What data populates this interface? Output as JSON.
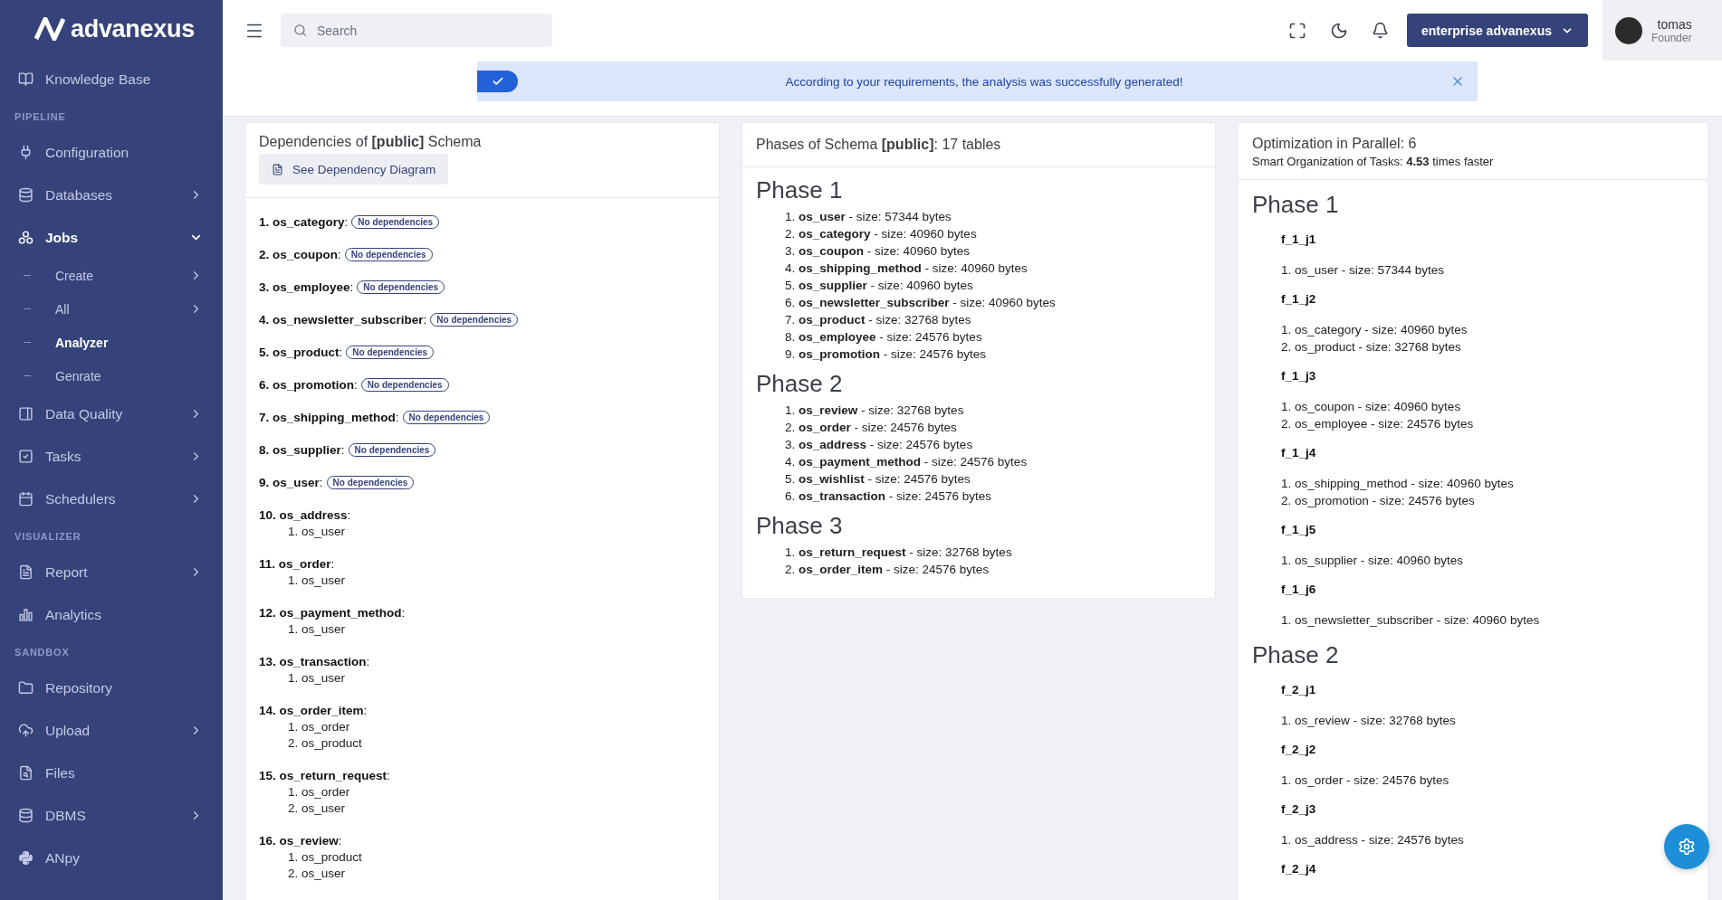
{
  "sidebar": {
    "logo": "advanexus",
    "items": [
      {
        "kind": "link",
        "label": "Knowledge Base",
        "selected": false
      },
      {
        "kind": "section",
        "label": "PIPELINE"
      },
      {
        "kind": "link",
        "label": "Configuration",
        "selected": false
      },
      {
        "kind": "group",
        "label": "Databases",
        "expanded": false
      },
      {
        "kind": "group",
        "label": "Jobs",
        "expanded": true
      },
      {
        "kind": "subgroup",
        "label": "Create",
        "expanded": false
      },
      {
        "kind": "subgroup",
        "label": "All",
        "expanded": false
      },
      {
        "kind": "subitem",
        "label": "Analyzer",
        "selected": true
      },
      {
        "kind": "subitem",
        "label": "Genrate",
        "selected": false
      },
      {
        "kind": "group",
        "label": "Data Quality",
        "expanded": false
      },
      {
        "kind": "group",
        "label": "Tasks",
        "expanded": false
      },
      {
        "kind": "group",
        "label": "Schedulers",
        "expanded": false
      },
      {
        "kind": "section",
        "label": "VISUALIZER"
      },
      {
        "kind": "group",
        "label": "Report",
        "expanded": false
      },
      {
        "kind": "link",
        "label": "Analytics",
        "selected": false
      },
      {
        "kind": "section",
        "label": "SANDBOX"
      },
      {
        "kind": "link",
        "label": "Repository",
        "selected": false
      },
      {
        "kind": "group",
        "label": "Upload",
        "expanded": false
      },
      {
        "kind": "link",
        "label": "Files",
        "selected": false
      },
      {
        "kind": "group",
        "label": "DBMS",
        "expanded": false
      },
      {
        "kind": "link",
        "label": "ANpy",
        "selected": false
      }
    ]
  },
  "topbar": {
    "search": {
      "placeholder": "Search"
    },
    "org_button": "enterprise advanexus",
    "user": {
      "name": "tomas",
      "role": "Founder"
    }
  },
  "alert": {
    "message": "According to your requirements, the analysis was successfully generated!"
  },
  "dependencies": {
    "title": "Dependencies of **[public]** Schema",
    "button": "See Dependency Diagram",
    "items": [
      {
        "label": "**1. os_category**:",
        "badge": "No dependencies"
      },
      {
        "label": "**2. os_coupon**:",
        "badge": "No dependencies"
      },
      {
        "label": "**3. os_employee**:",
        "badge": "No dependencies"
      },
      {
        "label": "**4. os_newsletter_subscriber**:",
        "badge": "No dependencies"
      },
      {
        "label": "**5. os_product**:",
        "badge": "No dependencies"
      },
      {
        "label": "**6. os_promotion**:",
        "badge": "No dependencies"
      },
      {
        "label": "**7. os_shipping_method**:",
        "badge": "No dependencies"
      },
      {
        "label": "**8. os_supplier**:",
        "badge": "No dependencies"
      },
      {
        "label": "**9. os_user**:",
        "badge": "No dependencies"
      },
      {
        "label": "**10. os_address**:",
        "children": [
          "1. os_user"
        ]
      },
      {
        "label": "**11. os_order**:",
        "children": [
          "1. os_user"
        ]
      },
      {
        "label": "**12. os_payment_method**:",
        "children": [
          "1. os_user"
        ]
      },
      {
        "label": "**13. os_transaction**:",
        "children": [
          "1. os_user"
        ]
      },
      {
        "label": "**14. os_order_item**:",
        "children": [
          "1. os_order",
          "2. os_product"
        ]
      },
      {
        "label": "**15. os_return_request**:",
        "children": [
          "1. os_order",
          "2. os_user"
        ]
      },
      {
        "label": "**16. os_review**:",
        "children": [
          "1. os_product",
          "2. os_user"
        ]
      }
    ]
  },
  "phases": {
    "title": "Phases of Schema **[public]**: 17 tables",
    "phases": [
      {
        "title": "Phase 1",
        "tables": [
          "1. **os_user** - size: 57344 bytes",
          "2. **os_category** - size: 40960 bytes",
          "3. **os_coupon** - size: 40960 bytes",
          "4. **os_shipping_method** - size: 40960 bytes",
          "5. **os_supplier** - size: 40960 bytes",
          "6. **os_newsletter_subscriber** - size: 40960 bytes",
          "7. **os_product** - size: 32768 bytes",
          "8. **os_employee** - size: 24576 bytes",
          "9. **os_promotion** - size: 24576 bytes"
        ]
      },
      {
        "title": "Phase 2",
        "tables": [
          "1. **os_review** - size: 32768 bytes",
          "2. **os_order** - size: 24576 bytes",
          "3. **os_address** - size: 24576 bytes",
          "4. **os_payment_method** - size: 24576 bytes",
          "5. **os_wishlist** - size: 24576 bytes",
          "6. **os_transaction** - size: 24576 bytes"
        ]
      },
      {
        "title": "Phase 3",
        "tables": [
          "1. **os_return_request** - size: 32768 bytes",
          "2. **os_order_item** - size: 24576 bytes"
        ]
      }
    ]
  },
  "optimization": {
    "title": "Optimization in Parallel: 6",
    "subtitle": "Smart Organization of Tasks: **4.53** times faster",
    "phases": [
      {
        "title": "Phase 1",
        "jobs": [
          {
            "name": "f_1_j1",
            "tables": [
              "1. os_user - size: 57344 bytes"
            ]
          },
          {
            "name": "f_1_j2",
            "tables": [
              "1. os_category - size: 40960 bytes",
              "2. os_product - size: 32768 bytes"
            ]
          },
          {
            "name": "f_1_j3",
            "tables": [
              "1. os_coupon - size: 40960 bytes",
              "2. os_employee - size: 24576 bytes"
            ]
          },
          {
            "name": "f_1_j4",
            "tables": [
              "1. os_shipping_method - size: 40960 bytes",
              "2. os_promotion - size: 24576 bytes"
            ]
          },
          {
            "name": "f_1_j5",
            "tables": [
              "1. os_supplier - size: 40960 bytes"
            ]
          },
          {
            "name": "f_1_j6",
            "tables": [
              "1. os_newsletter_subscriber - size: 40960 bytes"
            ]
          }
        ]
      },
      {
        "title": "Phase 2",
        "jobs": [
          {
            "name": "f_2_j1",
            "tables": [
              "1. os_review - size: 32768 bytes"
            ]
          },
          {
            "name": "f_2_j2",
            "tables": [
              "1. os_order - size: 24576 bytes"
            ]
          },
          {
            "name": "f_2_j3",
            "tables": [
              "1. os_address - size: 24576 bytes"
            ]
          },
          {
            "name": "f_2_j4"
          }
        ]
      }
    ]
  }
}
